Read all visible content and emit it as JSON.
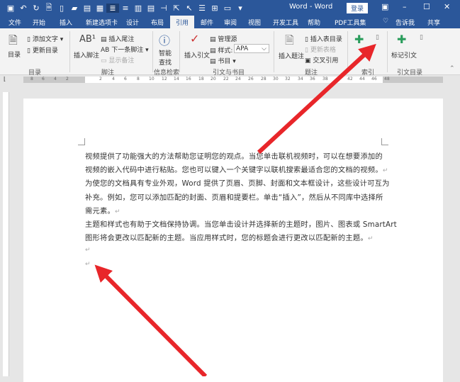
{
  "titlebar": {
    "title": "Word - Word",
    "login": "登录",
    "quick_access": [
      "save-icon",
      "undo-icon",
      "redo-icon",
      "print-preview-icon",
      "new-icon",
      "open-icon",
      "paste-icon",
      "format-icon",
      "read-mode-icon",
      "align-icon",
      "columns-icon",
      "copy-icon",
      "spacing-icon",
      "select-icon",
      "cursor-icon",
      "bullets-icon",
      "table-icon",
      "field-icon",
      "customize-icon"
    ]
  },
  "tabs": [
    "文件",
    "开始",
    "插入",
    "新建选项卡",
    "设计",
    "布局",
    "引用",
    "邮件",
    "审阅",
    "视图",
    "开发工具",
    "帮助",
    "PDF工具集"
  ],
  "tell_me": "告诉我",
  "share": "共享",
  "ribbon": {
    "toc": {
      "button": "目录",
      "add_text": "添加文字",
      "update": "更新目录",
      "group": "目录"
    },
    "footnotes": {
      "insert": "插入脚注",
      "endnote": "插入尾注",
      "next": "下一条脚注",
      "show": "显示备注",
      "group": "脚注"
    },
    "research": {
      "smart": "智能",
      "lookup": "查找",
      "group": "信息检索"
    },
    "citations": {
      "insert": "插入引文",
      "manage": "管理源",
      "style_label": "样式:",
      "style_value": "APA",
      "bib": "书目",
      "group": "引文与书目"
    },
    "captions": {
      "insert": "插入题注",
      "tof": "插入表目录",
      "update": "更新表格",
      "cross": "交叉引用",
      "group": "题注"
    },
    "index": {
      "group": "索引"
    },
    "authorities": {
      "mark": "标记引文",
      "group": "引文目录"
    }
  },
  "ruler": [
    "8",
    "6",
    "4",
    "2",
    "2",
    "4",
    "6",
    "8",
    "10",
    "12",
    "14",
    "16",
    "18",
    "20",
    "22",
    "24",
    "26",
    "28",
    "30",
    "32",
    "34",
    "36",
    "38",
    "42",
    "44",
    "46",
    "48"
  ],
  "document": {
    "lines": [
      "视频提供了功能强大的方法帮助您证明您的观点。当您单击联机视频时，可以在想要添加的",
      "视频的嵌入代码中进行粘贴。您也可以键入一个关键字以联机搜索最适合您的文档的视频。",
      "为使您的文档具有专业外观，Word 提供了页眉、页脚、封面和文本框设计，这些设计可互为",
      "补充。例如，您可以添加匹配的封面、页眉和提要栏。单击“插入”，然后从不同库中选择所",
      "需元素。",
      "主题和样式也有助于文档保持协调。当您单击设计并选择新的主题时，图片、图表或 SmartArt",
      "图形将会更改以匹配新的主题。当应用样式时，您的标题会进行更改以匹配新的主题。",
      "",
      ""
    ],
    "para_marks": [
      false,
      true,
      false,
      false,
      true,
      false,
      true,
      true,
      true
    ],
    "para_mark": "↵"
  },
  "colors": {
    "accent": "#2b579a",
    "arrow": "#e8262a"
  }
}
